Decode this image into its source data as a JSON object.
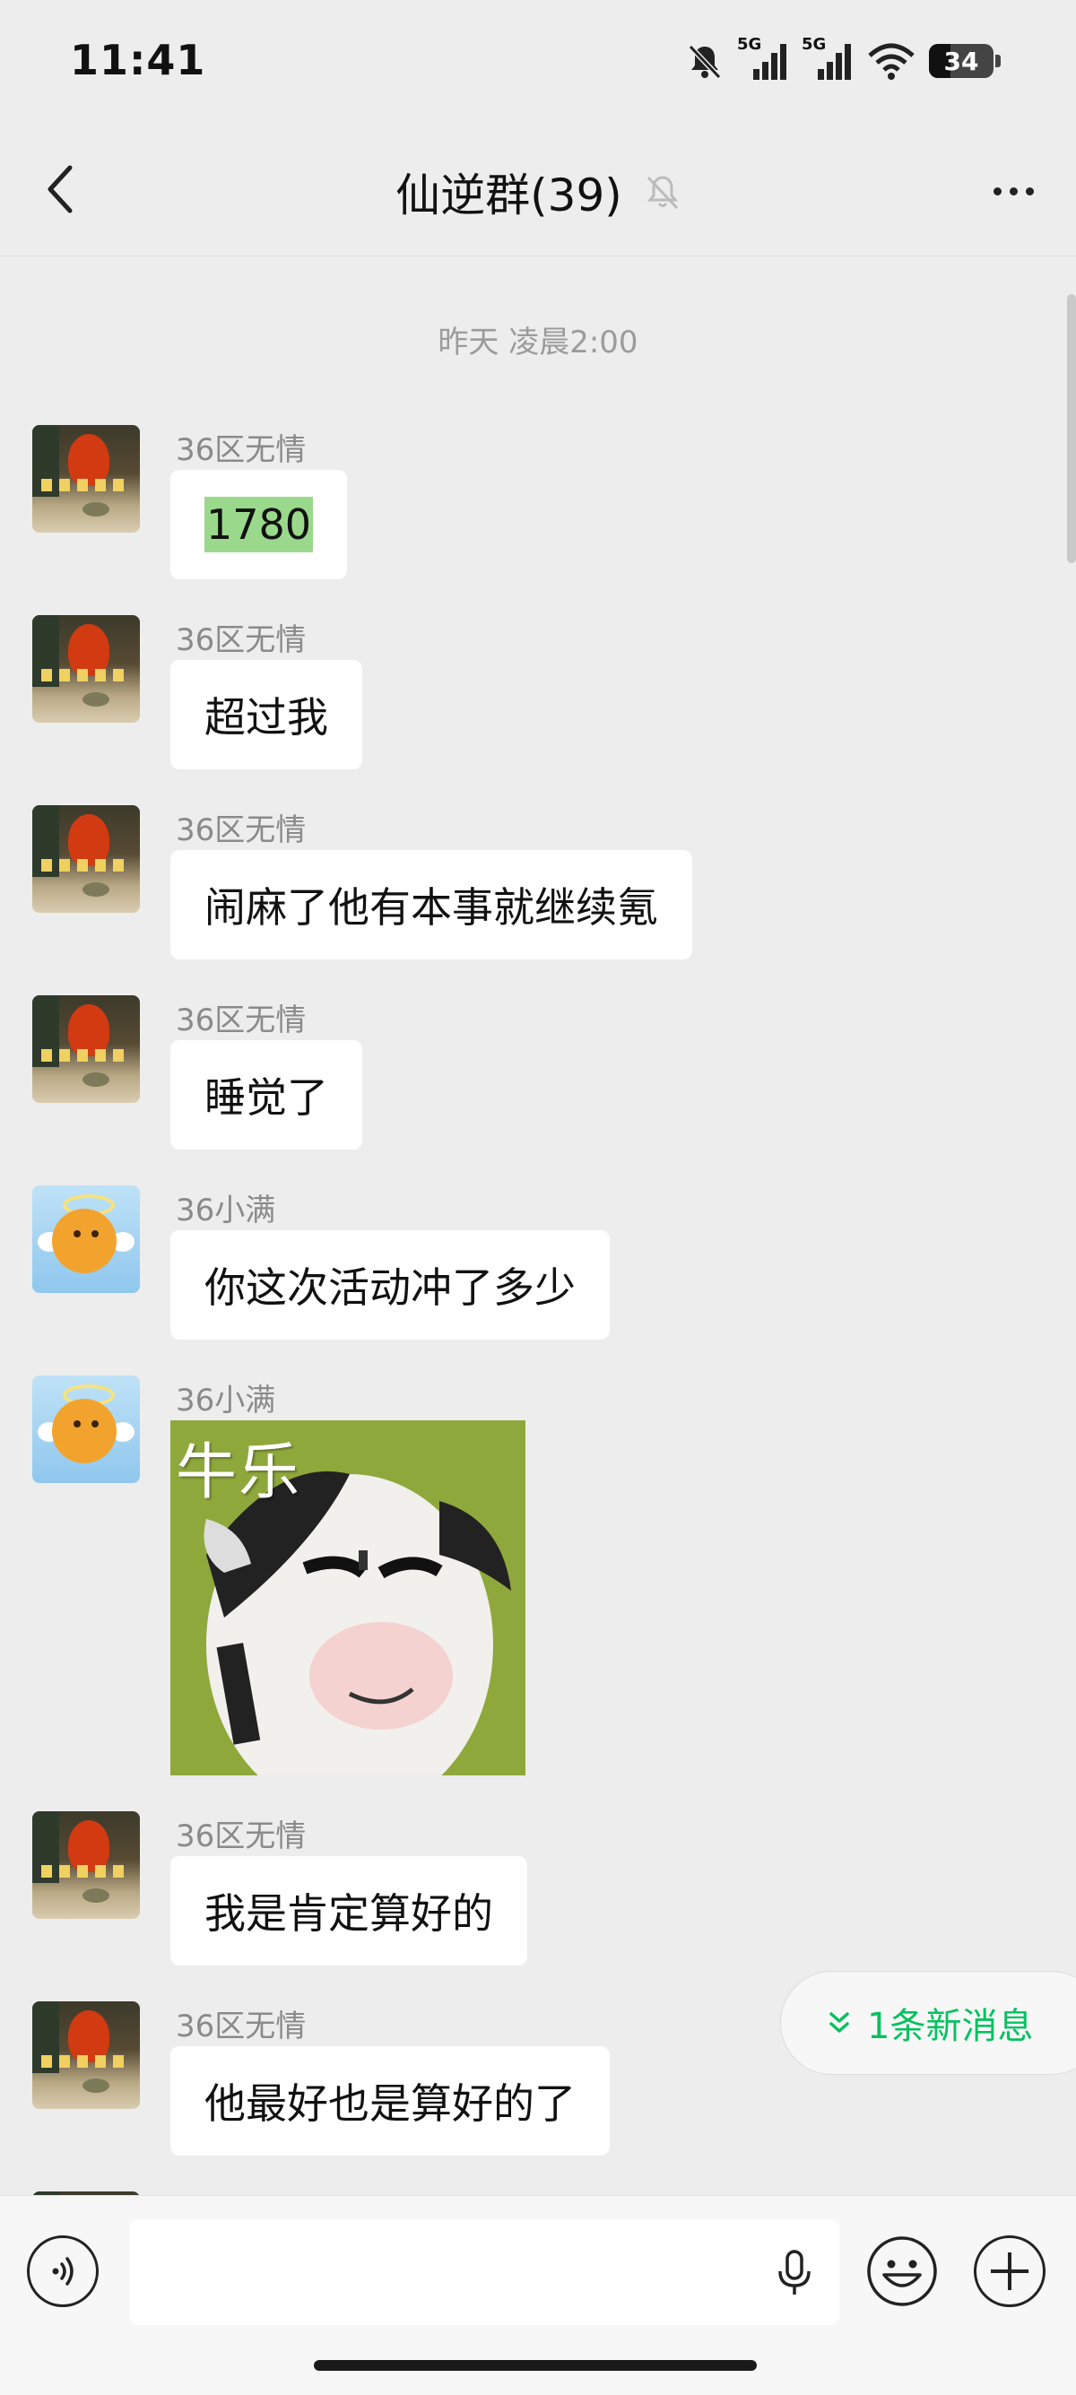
{
  "status_bar": {
    "time": "11:41",
    "signal1_label": "5G",
    "signal2_label": "5G",
    "battery": "34",
    "battery_level": 0.34
  },
  "nav": {
    "title": "仙逆群(39)",
    "back_icon": "chevron-left-icon",
    "mute_icon": "bell-muted-icon",
    "more_icon": "more-dots-icon"
  },
  "chat": {
    "timestamp": "昨天 凌晨2:00",
    "messages": [
      {
        "sender": "36区无情",
        "text": "1780",
        "type": "text",
        "highlighted": true
      },
      {
        "sender": "36区无情",
        "text": "超过我",
        "type": "text"
      },
      {
        "sender": "36区无情",
        "text": "闹麻了他有本事就继续氪",
        "type": "text"
      },
      {
        "sender": "36区无情",
        "text": "睡觉了",
        "type": "text"
      },
      {
        "sender": "36小满",
        "text": "你这次活动冲了多少",
        "type": "text"
      },
      {
        "sender": "36小满",
        "sticker_text": "牛乐",
        "type": "sticker"
      },
      {
        "sender": "36区无情",
        "text": "我是肯定算好的",
        "type": "text"
      },
      {
        "sender": "36区无情",
        "text": "他最好也是算好的了",
        "type": "text"
      }
    ],
    "new_message_badge": "1条新消息"
  },
  "input_bar": {
    "voice_icon": "voice-toggle-icon",
    "mic_icon": "microphone-icon",
    "emoji_icon": "emoji-icon",
    "plus_icon": "plus-icon",
    "placeholder": ""
  },
  "colors": {
    "accent_green": "#07c160",
    "highlight": "#9ad98c",
    "background": "#ededed"
  }
}
